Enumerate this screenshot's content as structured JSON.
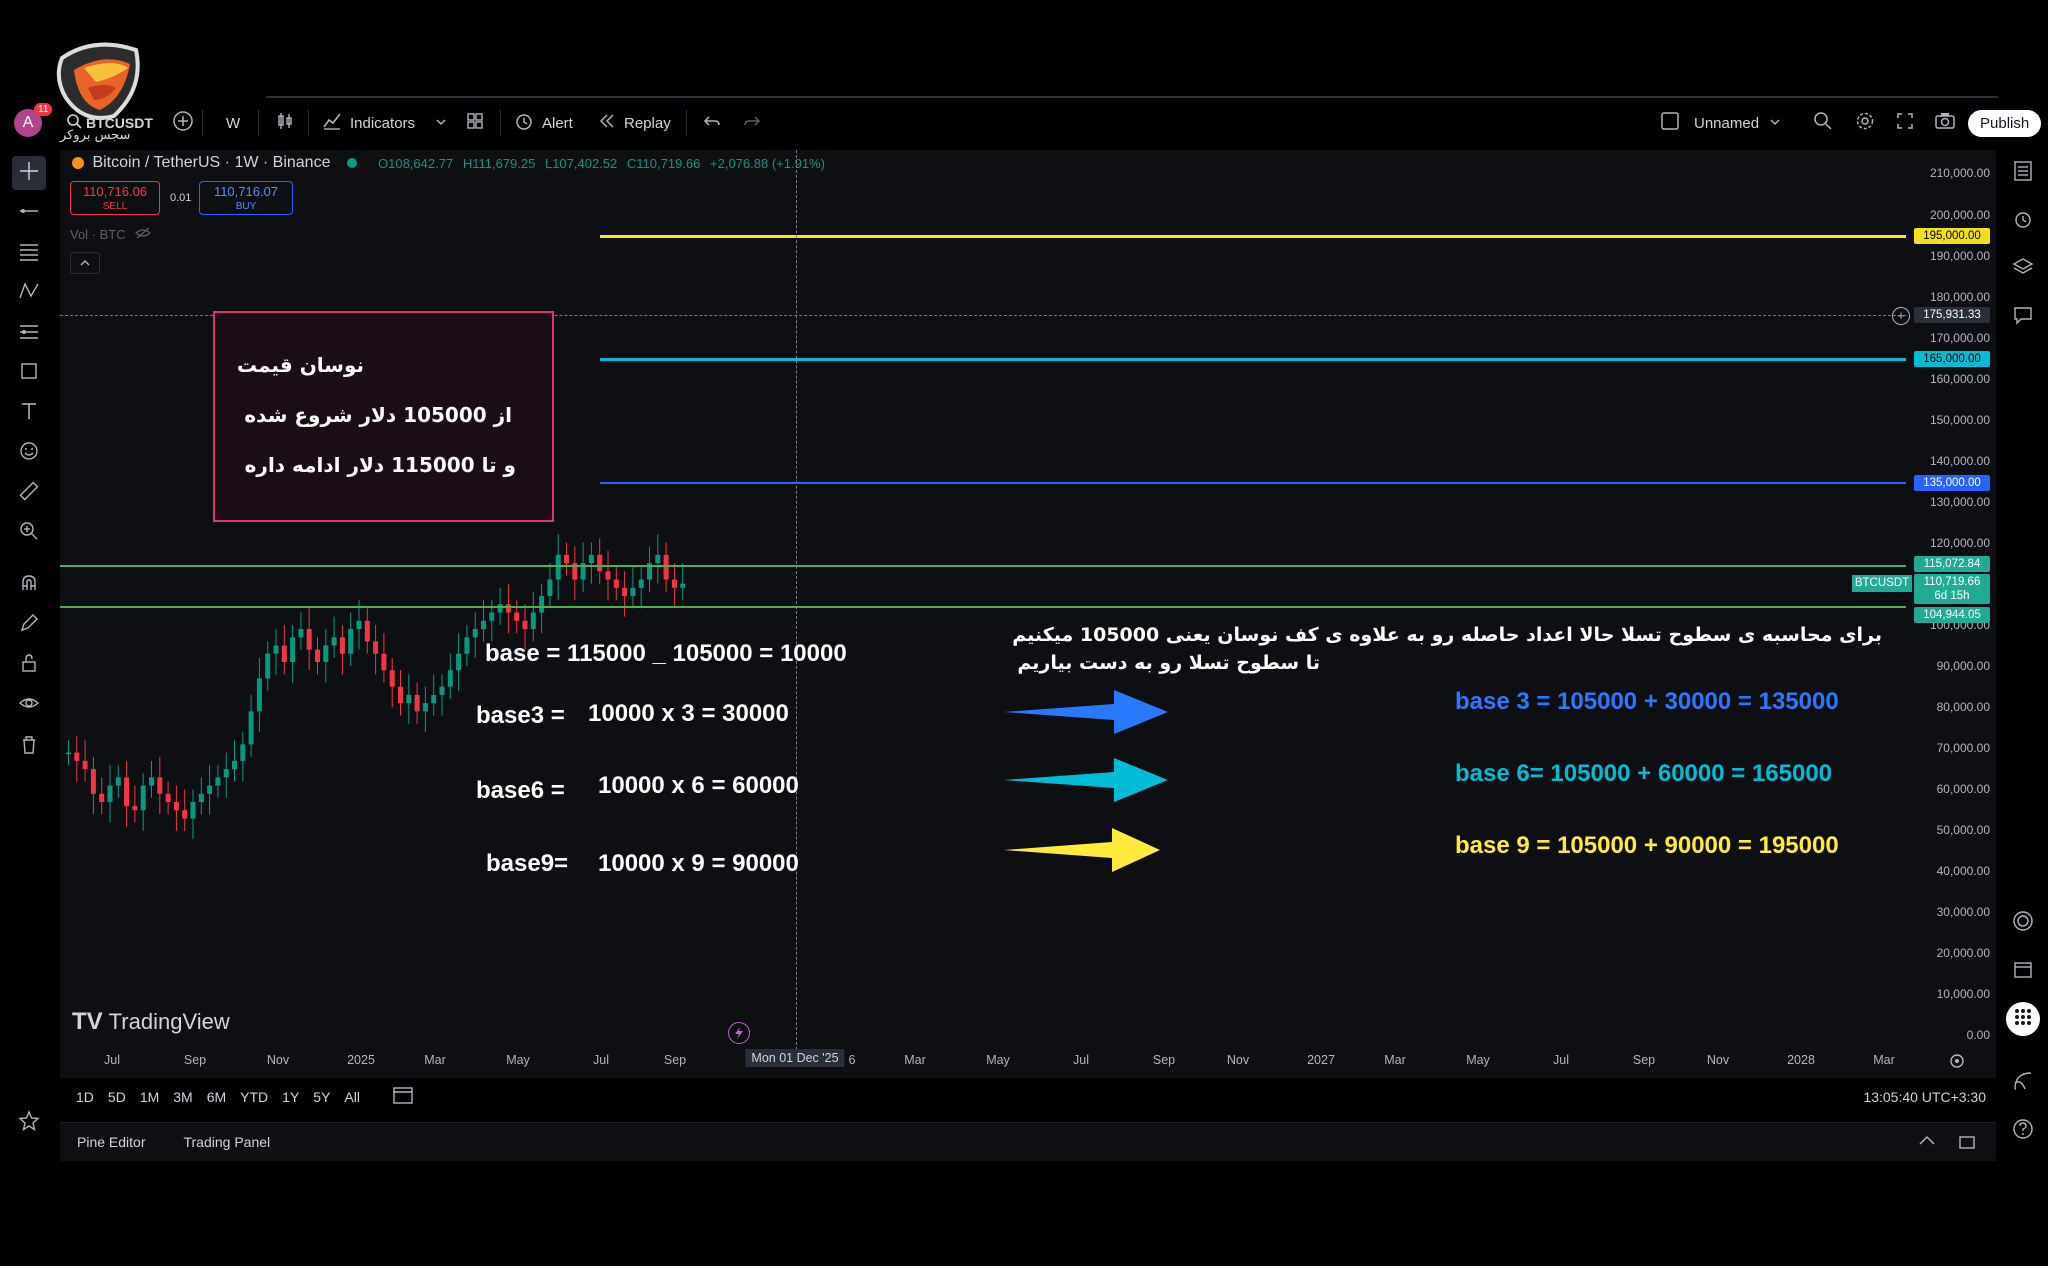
{
  "toolbar": {
    "avatar_letter": "A",
    "notification_count": "11",
    "symbol": "BTCUSDT",
    "interval": "W",
    "indicators_label": "Indicators",
    "alert_label": "Alert",
    "replay_label": "Replay",
    "layout_name": "Unnamed",
    "publish_label": "Publish"
  },
  "logo_text": "سجس بروکر",
  "chart_header": {
    "title": "Bitcoin / TetherUS · 1W · Binance",
    "open": "O108,642.77",
    "high": "H111,679.25",
    "low": "L107,402.52",
    "close": "C110,719.66",
    "change": "+2,076.88 (+1.91%)",
    "sell_price": "110,716.06",
    "sell_label": "SELL",
    "spread": "0.01",
    "buy_price": "110,716.07",
    "buy_label": "BUY",
    "volume_label": "Vol · BTC"
  },
  "y_axis": {
    "labels": [
      "210,000.00",
      "200,000.00",
      "190,000.00",
      "180,000.00",
      "170,000.00",
      "160,000.00",
      "150,000.00",
      "140,000.00",
      "130,000.00",
      "120,000.00",
      "100,000.00",
      "90,000.00",
      "80,000.00",
      "70,000.00",
      "60,000.00",
      "50,000.00",
      "40,000.00",
      "30,000.00",
      "20,000.00",
      "10,000.00",
      "0.00"
    ],
    "tags": [
      {
        "text": "195,000.00",
        "color": "#f0e01a"
      },
      {
        "text": "175,931.33",
        "color": "#2a2e39"
      },
      {
        "text": "165,000.00",
        "color": "#00bcd4"
      },
      {
        "text": "135,000.00",
        "color": "#2962ff"
      },
      {
        "text": "115,072.84",
        "color": "#22ab94"
      },
      {
        "text": "110,719.66",
        "color": "#22ab94"
      },
      {
        "text": "6d 15h",
        "color": "#22ab94"
      },
      {
        "text": "104,944.05",
        "color": "#22ab94"
      }
    ],
    "symbol_tag": "BTCUSDT"
  },
  "x_axis": {
    "labels": [
      "Jul",
      "Sep",
      "Nov",
      "2025",
      "Mar",
      "May",
      "Jul",
      "Sep",
      "Mon 01 Dec '25",
      "6",
      "Mar",
      "May",
      "Jul",
      "Sep",
      "Nov",
      "2027",
      "Mar",
      "May",
      "Jul",
      "Sep",
      "Nov",
      "2028",
      "Mar"
    ]
  },
  "annotations": {
    "box_line1": "نوسان قیمت",
    "box_line2": "از 105000 دلار شروع شده",
    "box_line3": "و تا 115000 دلار ادامه داره",
    "base": "base = 115000 _ 105000 = 10000",
    "base3_label": "base3 =",
    "base3_calc": "10000 x 3 = 30000",
    "base6_label": "base6 =",
    "base6_calc": "10000 x 6 = 60000",
    "base9_label": "base9=",
    "base9_calc": "10000 x 9 = 90000",
    "note_line1": "برای محاسبه ی سطوح تسلا حالا اعداد حاصله رو به علاوه ی کف نوسان یعنی 105000 میکنیم",
    "note_line2": "تا سطوح تسلا رو به دست بیاریم",
    "result3": "base 3 = 105000 + 30000 = 135000",
    "result6": "base 6= 105000 + 60000 = 165000",
    "result9": "base 9 = 105000 + 90000 = 195000"
  },
  "colors": {
    "yellow": "#f5e71a",
    "cyan": "#00bcd4",
    "blue": "#2962ff",
    "green": "#4caf50",
    "up": "#089981",
    "down": "#f23645"
  },
  "watermark": "TradingView",
  "bottom": {
    "periods": [
      "1D",
      "5D",
      "1M",
      "3M",
      "6M",
      "YTD",
      "1Y",
      "5Y",
      "All"
    ],
    "clock": "13:05:40 UTC+3:30",
    "pine_editor": "Pine Editor",
    "trading_panel": "Trading Panel"
  }
}
